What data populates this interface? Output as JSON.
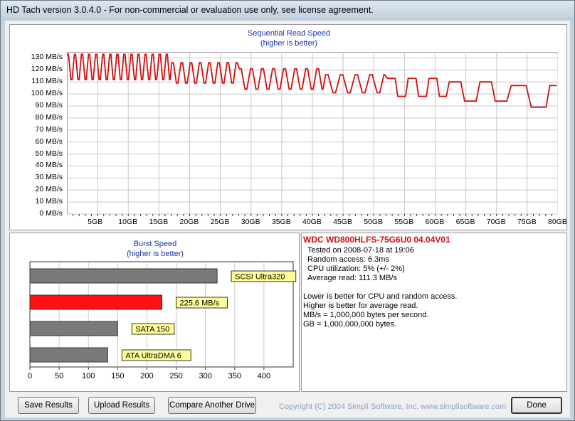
{
  "window": {
    "title": "HD Tach version 3.0.4.0  - For non-commercial or evaluation use only, see license agreement."
  },
  "seq_chart": {
    "title": "Sequential Read Speed",
    "subtitle": "(higher is better)"
  },
  "burst_chart": {
    "title": "Burst Speed",
    "subtitle": "(higher is better)"
  },
  "info": {
    "drive": "WDC WD800HLFS-75G6U0 04.04V01",
    "tested_on": "Tested on 2008-07-18 at 19:06",
    "random_access": "Random access: 6.3ms",
    "cpu": "CPU utilization: 5% (+/- 2%)",
    "avg_read": "Average read: 111.3 MB/s",
    "note1": "Lower is better for CPU and random access.",
    "note2": "Higher is better for average read.",
    "note3": "MB/s = 1,000,000 bytes per second.",
    "note4": "GB = 1,000,000,000 bytes."
  },
  "buttons": {
    "save": "Save Results",
    "upload": "Upload Results",
    "compare": "Compare Another Drive",
    "done": "Done"
  },
  "copyright": "Copyright (C) 2004 Simpli Software, Inc. www.simplisoftware.com",
  "colors": {
    "line": "#d01010",
    "highlight_bar": "#ff1010",
    "gray_bar": "#7a7a7a",
    "label_bg": "#ffff99",
    "title_blue": "#1a33a8"
  },
  "chart_data": [
    {
      "type": "line",
      "title": "Sequential Read Speed",
      "subtitle": "(higher is better)",
      "y_ticks": [
        "0 MB/s",
        "10 MB/s",
        "20 MB/s",
        "30 MB/s",
        "40 MB/s",
        "50 MB/s",
        "60 MB/s",
        "70 MB/s",
        "80 MB/s",
        "90 MB/s",
        "100 MB/s",
        "110 MB/s",
        "120 MB/s",
        "130 MB/s"
      ],
      "x_ticks": [
        "5GB",
        "10GB",
        "15GB",
        "20GB",
        "25GB",
        "30GB",
        "35GB",
        "40GB",
        "45GB",
        "50GB",
        "55GB",
        "60GB",
        "65GB",
        "70GB",
        "75GB",
        "80GB"
      ],
      "xlim": [
        0,
        80
      ],
      "ylim": [
        0,
        135
      ],
      "grid": true,
      "segments": [
        {
          "start": 0,
          "end": 17,
          "hi": 133,
          "lo": 112,
          "period": 1.15
        },
        {
          "start": 17,
          "end": 28,
          "hi": 126,
          "lo": 109,
          "period": 1.5
        },
        {
          "start": 28,
          "end": 42,
          "hi": 121,
          "lo": 104,
          "period": 1.8
        },
        {
          "start": 42,
          "end": 52,
          "hi": 116,
          "lo": 101,
          "period": 2.4
        },
        {
          "start": 52,
          "end": 62,
          "hi": 113,
          "lo": 98,
          "period": 3.4
        },
        {
          "start": 62,
          "end": 72,
          "hi": 110,
          "lo": 94,
          "period": 5.0
        },
        {
          "start": 72,
          "end": 80,
          "hi": 107,
          "lo": 89,
          "period": 6.5
        }
      ]
    },
    {
      "type": "bar",
      "title": "Burst Speed",
      "subtitle": "(higher is better)",
      "categories": [
        "SCSI Ultra320",
        "225.6 MB/s",
        "SATA 150",
        "ATA UltraDMA 6"
      ],
      "values": [
        320,
        225.6,
        150,
        133
      ],
      "highlight_index": 1,
      "x_ticks": [
        "0",
        "50",
        "100",
        "150",
        "200",
        "250",
        "300",
        "350",
        "400"
      ],
      "xlim": [
        0,
        450
      ],
      "grid": true
    }
  ]
}
